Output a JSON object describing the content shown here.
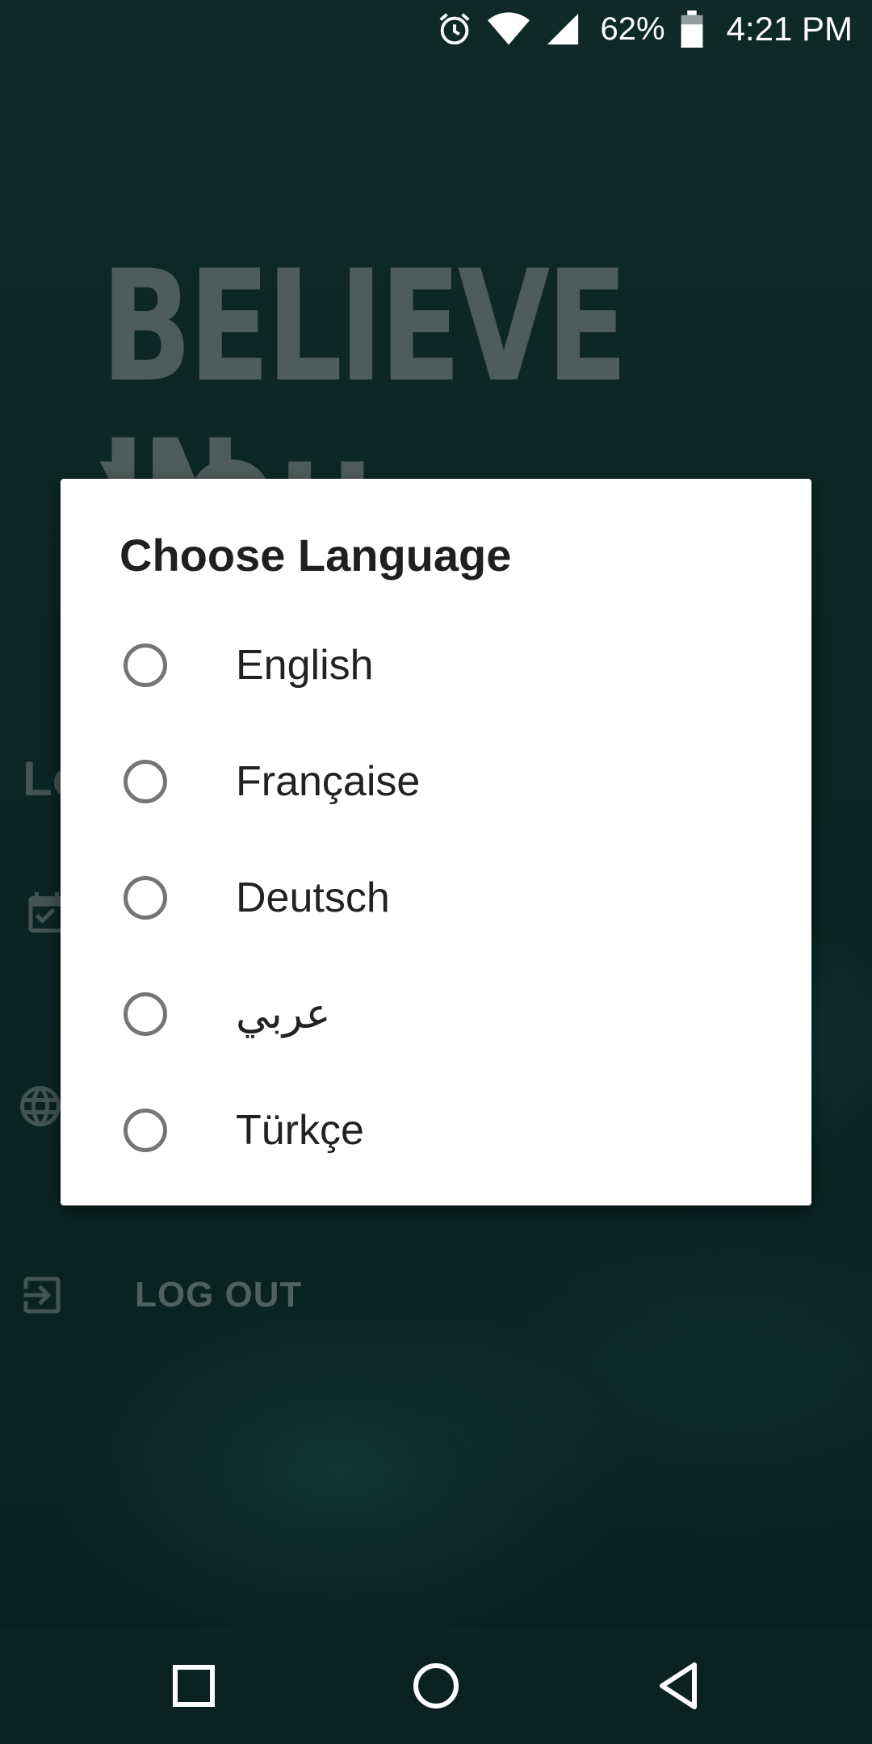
{
  "status_bar": {
    "battery_percent": "62%",
    "time": "4:21 PM",
    "icons": [
      "alarm-icon",
      "wifi-icon",
      "signal-icon",
      "battery-icon"
    ]
  },
  "background": {
    "poster_line1": "BELIEVE IN",
    "poster_line2": "YOU",
    "partial_title": "Lo",
    "logout_label": "LOG OUT",
    "icons": [
      "calendar-check-icon",
      "globe-icon",
      "logout-icon"
    ]
  },
  "dialog": {
    "title": "Choose Language",
    "options": [
      {
        "label": "English",
        "selected": false
      },
      {
        "label": "Française",
        "selected": false
      },
      {
        "label": "Deutsch",
        "selected": false
      },
      {
        "label": "عربي",
        "selected": false
      },
      {
        "label": "Türkçe",
        "selected": false
      }
    ]
  },
  "nav_bar": {
    "icons": [
      "recents-square-icon",
      "home-circle-icon",
      "back-triangle-icon"
    ]
  },
  "colors": {
    "background_teal": "#123532",
    "dialog_bg": "#ffffff",
    "radio_outline": "#757575",
    "text_dark": "#222222"
  }
}
